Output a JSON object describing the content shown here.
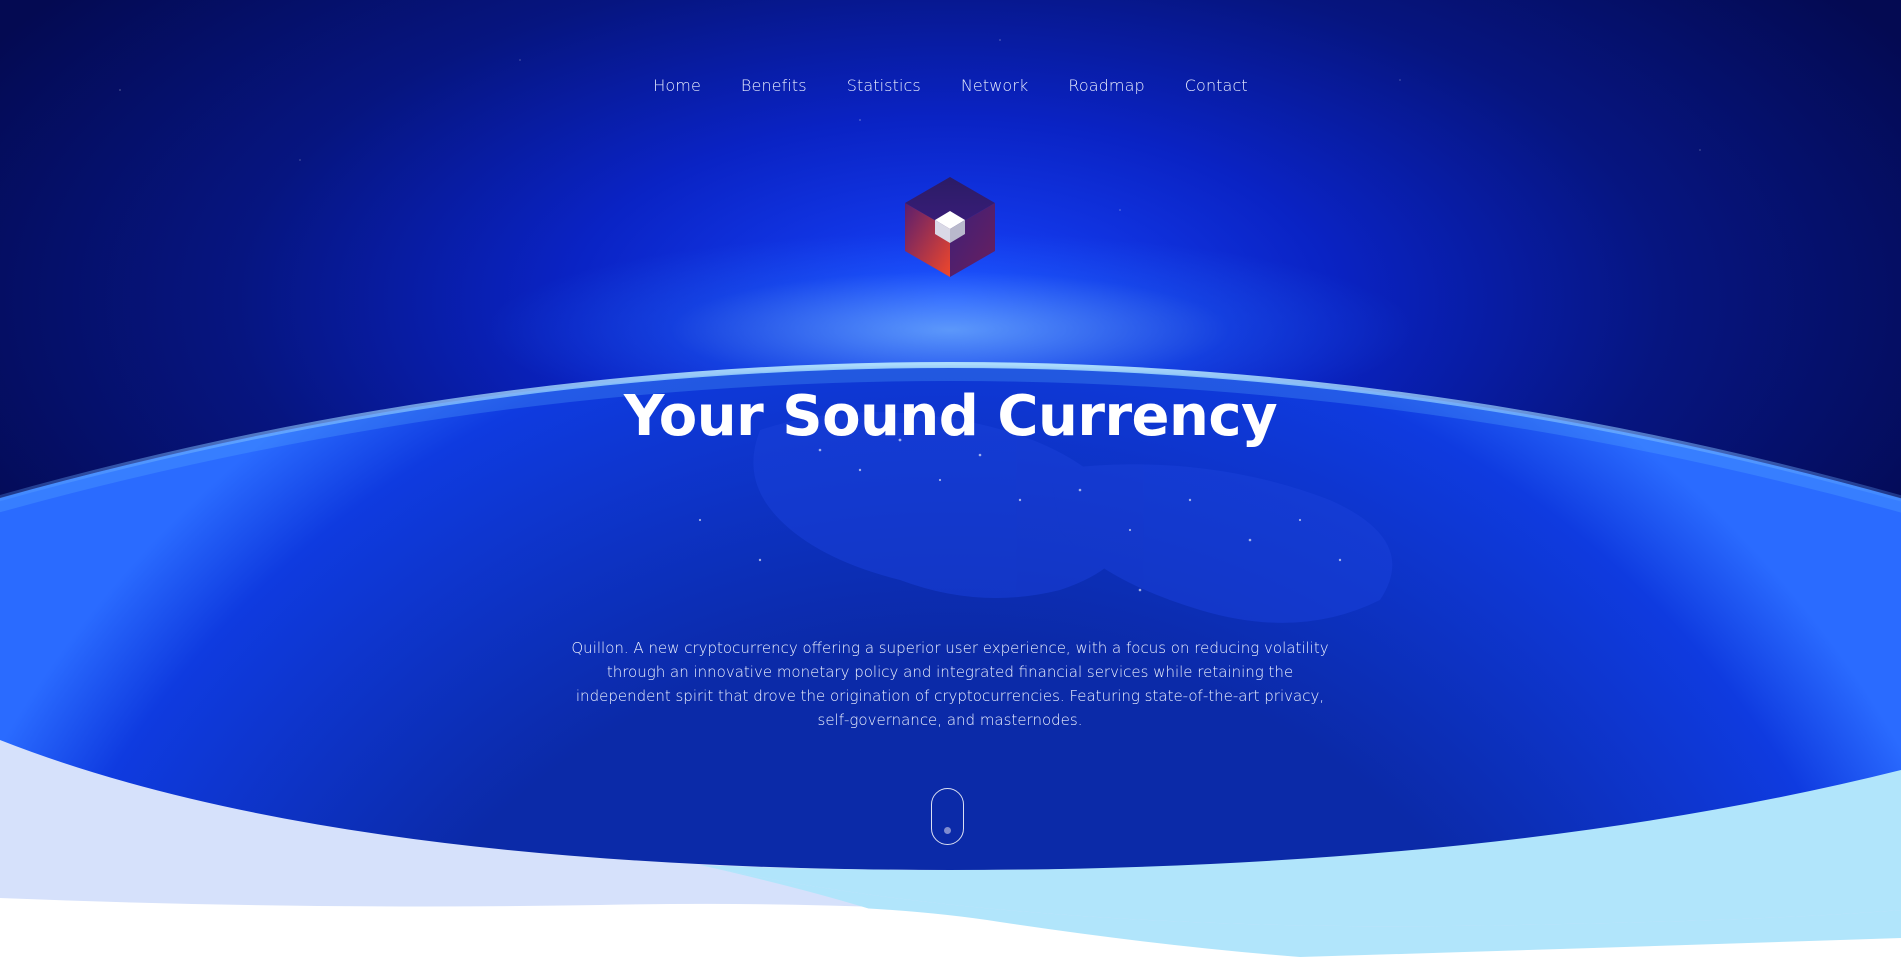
{
  "nav": {
    "items": [
      {
        "label": "Home"
      },
      {
        "label": "Benefits"
      },
      {
        "label": "Statistics"
      },
      {
        "label": "Network"
      },
      {
        "label": "Roadmap"
      },
      {
        "label": "Contact"
      }
    ]
  },
  "hero": {
    "logo_icon": "quillon-cube-logo-icon",
    "headline": "Your Sound Currency",
    "description": "Quillon. A new cryptocurrency offering a superior user experience, with a focus on reducing volatility through an innovative monetary policy and integrated financial services while retaining the independent spirit that drove the origination of cryptocurrencies. Featuring state-of-the-art privacy, self-governance, and masternodes.",
    "scroll_indicator_icon": "scroll-down-mouse-icon"
  },
  "colors": {
    "background_deep": "#040a52",
    "background_glow": "#1744ff",
    "atmosphere": "#96e1ff",
    "wave_light": "#d6e1fb",
    "wave_cyan": "#b1e5fb",
    "logo_red": "#e0412a",
    "logo_purple": "#3a1d6e"
  }
}
